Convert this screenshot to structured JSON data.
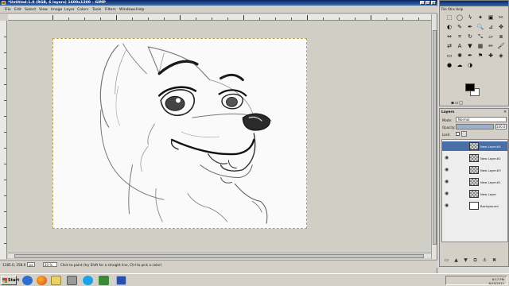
{
  "window": {
    "title": "*Untitled-1.0 (RGB, 6 layers) 1600x1200 – GIMP",
    "menus": [
      "File",
      "Edit",
      "Select",
      "View",
      "Image",
      "Layer",
      "Colors",
      "Tools",
      "Filters",
      "Windows",
      "Help"
    ]
  },
  "statusbar": {
    "coords": "1185.0, 258.0",
    "unit": "px",
    "zoom": "20 %",
    "message": "Click to paint (try Shift for a straight line, Ctrl to pick a color)"
  },
  "toolbox": {
    "menu": "File  Xtns  Help",
    "tools": [
      "rect-select",
      "ellipse-select",
      "free-select",
      "fuzzy-select",
      "color-select",
      "scissors",
      "foreground-select",
      "paths",
      "color-picker",
      "zoom",
      "measure",
      "move",
      "align",
      "crop",
      "rotate",
      "scale",
      "shear",
      "perspective",
      "flip",
      "text",
      "bucket-fill",
      "blend",
      "pencil",
      "paintbrush",
      "eraser",
      "airbrush",
      "ink",
      "clone",
      "heal",
      "perspective-clone",
      "blur",
      "smudge",
      "dodge-burn"
    ],
    "tool_glyphs": [
      "⬚",
      "◯",
      "ϟ",
      "✦",
      "▣",
      "✂",
      "◐",
      "✎",
      "✒",
      "🔍",
      "⊿",
      "✥",
      "⇔",
      "⌗",
      "↻",
      "⤡",
      "▱",
      "⧈",
      "⇄",
      "A",
      "▼",
      "▦",
      "✏",
      "🖌",
      "▭",
      "✺",
      "✒",
      "⚑",
      "✚",
      "◈",
      "●",
      "☁",
      "◑"
    ],
    "colors": {
      "foreground": "#000000",
      "background": "#ffffff"
    }
  },
  "layers": {
    "title": "Layers",
    "mode_label": "Mode:",
    "mode": "Normal",
    "opacity_label": "Opacity:",
    "opacity": 100,
    "opacity_text": "100.0",
    "lock_label": "Lock:",
    "items": [
      {
        "name": "New Layer#4",
        "selected": true,
        "visible": false
      },
      {
        "name": "New Layer#2",
        "selected": false,
        "visible": true
      },
      {
        "name": "New Layer#3",
        "selected": false,
        "visible": true
      },
      {
        "name": "New Layer#1",
        "selected": false,
        "visible": true
      },
      {
        "name": "New Layer",
        "selected": false,
        "visible": true
      },
      {
        "name": "Background",
        "selected": false,
        "visible": true
      }
    ]
  },
  "taskbar": {
    "start": "Start",
    "clock_time": "6:17 PM",
    "clock_date": "6/15/2011"
  }
}
